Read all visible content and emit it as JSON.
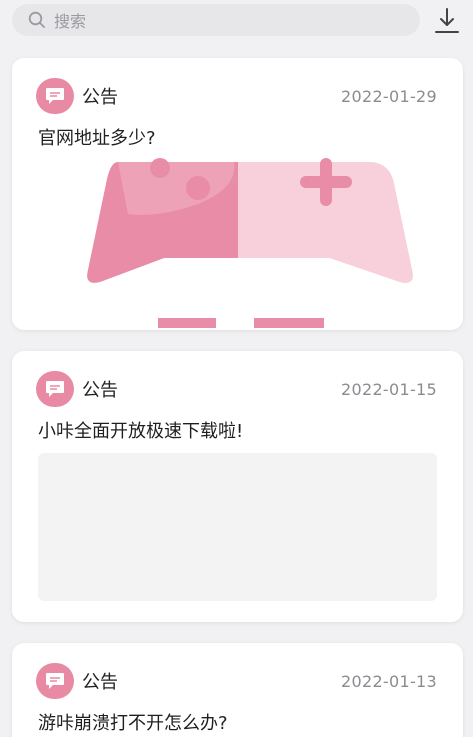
{
  "search": {
    "placeholder": "搜索"
  },
  "icons": {
    "search": "search-icon",
    "download": "download-icon",
    "announcement": "message-bubble-icon"
  },
  "colors": {
    "accent": "#e88aa3",
    "background": "#f1f1f3",
    "card": "#ffffff"
  },
  "posts": [
    {
      "tag": "公告",
      "date": "2022-01-29",
      "title": "官网地址多少?"
    },
    {
      "tag": "公告",
      "date": "2022-01-15",
      "title": "小咔全面开放极速下载啦!"
    },
    {
      "tag": "公告",
      "date": "2022-01-13",
      "title": "游咔崩溃打不开怎么办?"
    }
  ]
}
